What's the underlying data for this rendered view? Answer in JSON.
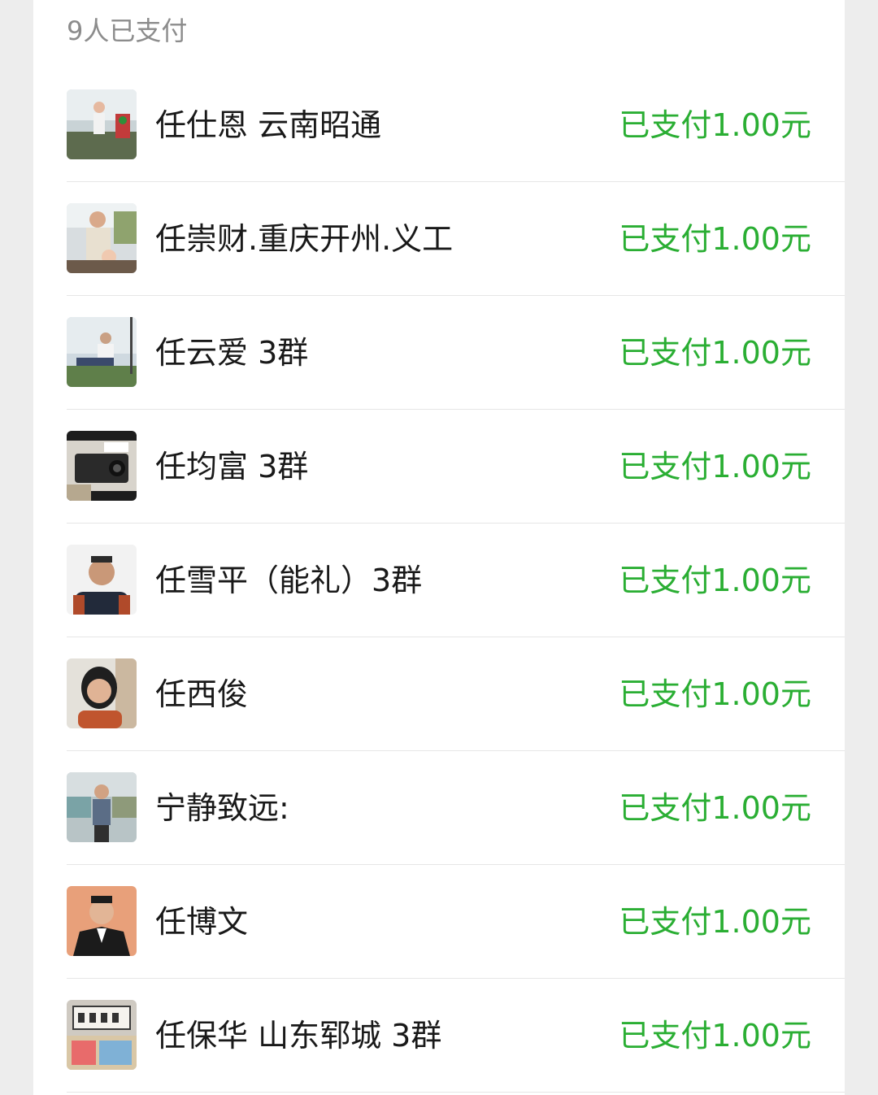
{
  "header": {
    "title": "9人已支付"
  },
  "accent_color": "#2aae33",
  "payers": [
    {
      "name": "任仕恩 云南昭通",
      "status": "已支付1.00元",
      "avatar_icon": "person-photo-avatar"
    },
    {
      "name": "任崇财.重庆开州.义工",
      "status": "已支付1.00元",
      "avatar_icon": "person-photo-avatar"
    },
    {
      "name": "任云爱 3群",
      "status": "已支付1.00元",
      "avatar_icon": "person-photo-avatar"
    },
    {
      "name": "任均富 3群",
      "status": "已支付1.00元",
      "avatar_icon": "car-photo-avatar"
    },
    {
      "name": "任雪平（能礼）3群",
      "status": "已支付1.00元",
      "avatar_icon": "person-photo-avatar"
    },
    {
      "name": "任西俊",
      "status": "已支付1.00元",
      "avatar_icon": "person-photo-avatar"
    },
    {
      "name": "宁静致远:",
      "status": "已支付1.00元",
      "avatar_icon": "person-photo-avatar"
    },
    {
      "name": "任博文",
      "status": "已支付1.00元",
      "avatar_icon": "person-photo-avatar"
    },
    {
      "name": "任保华 山东郓城 3群",
      "status": "已支付1.00元",
      "avatar_icon": "calligraphy-photo-avatar"
    }
  ]
}
